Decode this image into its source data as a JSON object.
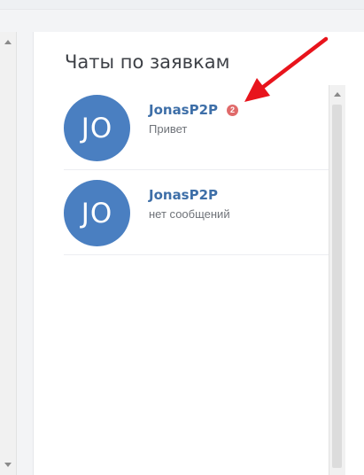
{
  "panel": {
    "title": "Чаты по заявкам"
  },
  "chats": [
    {
      "initials": "JO",
      "name": "JonasP2P",
      "preview": "Привет",
      "unread": "2"
    },
    {
      "initials": "JO",
      "name": "JonasP2P",
      "preview": "нет сообщений"
    }
  ],
  "colors": {
    "avatar": "#4a7fc1",
    "name": "#3e6fa8",
    "badge": "#e06a6a",
    "arrow": "#e8141c"
  }
}
